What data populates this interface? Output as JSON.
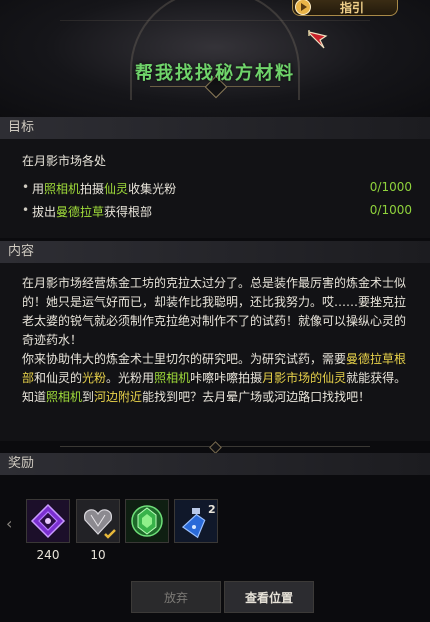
{
  "header": {
    "guide_label": "指引",
    "quest_title": "帮我找找秘方材料"
  },
  "goal": {
    "heading": "目标",
    "location": "在月影市场各处",
    "objectives": [
      {
        "bullet": "•",
        "pre": "用",
        "hl1": "照相机",
        "mid1": "拍摄",
        "hl2": "仙灵",
        "post": "收集光粉",
        "count": "0/1000"
      },
      {
        "bullet": "•",
        "pre": "拔出",
        "hl1": "曼德拉草",
        "post": "获得根部",
        "count": "0/1000"
      }
    ]
  },
  "content": {
    "heading": "内容",
    "p1": "在月影市场经营炼金工坊的克拉太过分了。总是装作最厉害的炼金术士似的！她只是运气好而已，却装作比我聪明，还比我努力。哎……要挫克拉老太婆的锐气就必须制作克拉绝对制作不了的试药！就像可以操纵心灵的奇迹药水！",
    "p2_a": "你来协助伟大的炼金术士里切尔的研究吧。为研究试药，需要",
    "p2_hl1": "曼德拉草根部",
    "p2_b": "和仙灵的",
    "p2_hl2": "光粉",
    "p2_c": "。光粉用",
    "p2_hl3": "照相机",
    "p2_d": "咔嚓咔嚓拍摄",
    "p2_hl4": "月影市场的仙灵",
    "p2_e": "就能获得。知道",
    "p2_hl5": "照相机",
    "p2_f": "到",
    "p2_hl6": "河边附近",
    "p2_g": "能找到吧？去月晕广场或河边路口找找吧！"
  },
  "rewards": {
    "heading": "奖励",
    "arrow": "‹",
    "items": [
      {
        "icon": "purple-gem-icon",
        "count": "240"
      },
      {
        "icon": "silver-heart-icon",
        "count": "10"
      },
      {
        "icon": "green-crystal-icon",
        "count": ""
      },
      {
        "icon": "blue-potion-icon",
        "badge": "2"
      }
    ]
  },
  "buttons": {
    "abandon": "放弃",
    "view_location": "查看位置"
  },
  "colors": {
    "title_green": "#6fd36a",
    "highlight_green": "#a0dc3a",
    "highlight_yellow": "#e8d24a",
    "count_green": "#8fd23c"
  }
}
